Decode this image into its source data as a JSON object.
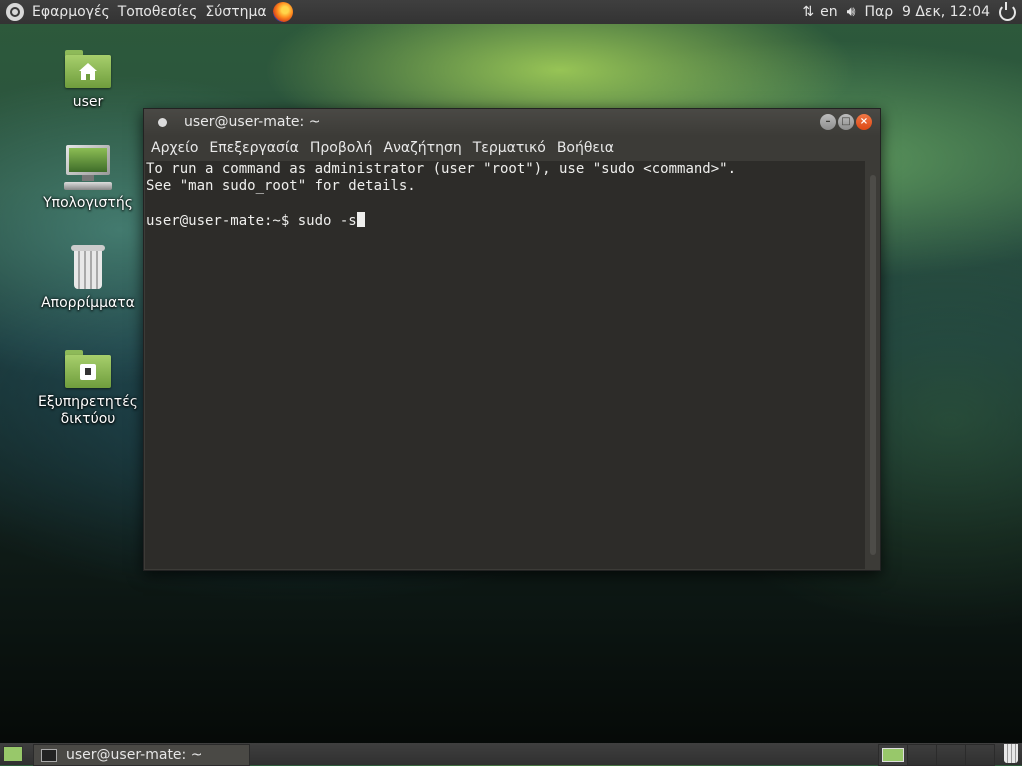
{
  "top_panel": {
    "menus": [
      "Εφαρμογές",
      "Τοποθεσίες",
      "Σύστημα"
    ],
    "keyboard_layout": "en",
    "clock": "Παρ  9 Δεκ, 12:04"
  },
  "desktop": {
    "icons": [
      {
        "label": "user",
        "icon": "home-folder-icon"
      },
      {
        "label": "Υπολογιστής",
        "icon": "computer-icon"
      },
      {
        "label": "Απορρίμματα",
        "icon": "trash-icon"
      },
      {
        "label": "Εξυπηρετητές δικτύου",
        "icon": "network-folder-icon"
      }
    ]
  },
  "terminal": {
    "title": "user@user-mate: ~",
    "menu": [
      "Αρχείο",
      "Επεξεργασία",
      "Προβολή",
      "Αναζήτηση",
      "Τερματικό",
      "Βοήθεια"
    ],
    "lines": [
      "To run a command as administrator (user \"root\"), use \"sudo <command>\".",
      "See \"man sudo_root\" for details.",
      "",
      "user@user-mate:~$ sudo -s"
    ]
  },
  "bottom_panel": {
    "task_label": "user@user-mate: ~"
  },
  "colors": {
    "accent_close": "#dd4814",
    "terminal_bg": "#2d2c29",
    "folder_green": "#8eba59"
  }
}
